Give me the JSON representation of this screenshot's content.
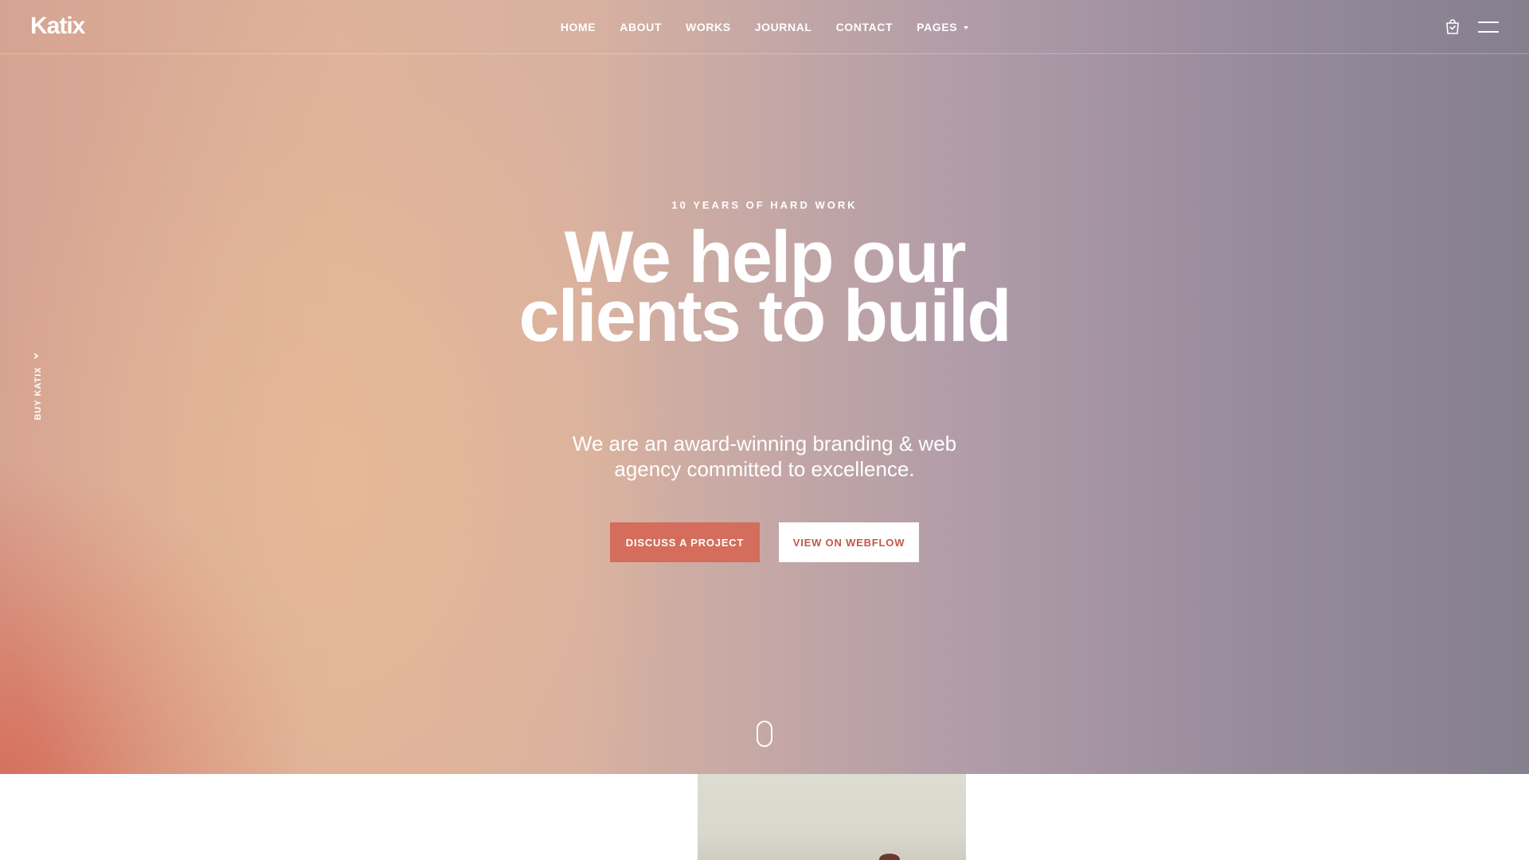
{
  "brand": {
    "logo": "Katix"
  },
  "nav": {
    "items": [
      {
        "label": "HOME"
      },
      {
        "label": "ABOUT"
      },
      {
        "label": "WORKS"
      },
      {
        "label": "JOURNAL"
      },
      {
        "label": "CONTACT"
      },
      {
        "label": "PAGES"
      }
    ]
  },
  "header_icons": {
    "cart": "cart-icon",
    "menu": "hamburger-icon"
  },
  "side": {
    "label": "BUY KATIX",
    "icon": "chevron-icon"
  },
  "hero": {
    "eyebrow": "10 YEARS OF HARD WORK",
    "headline_line1": "We help our",
    "headline_line2": "clients to build",
    "subtitle_line1": "We are an award-winning branding & web",
    "subtitle_line2": "agency committed to excellence.",
    "primary_button": "DISCUSS A PROJECT",
    "secondary_button": "VIEW ON WEBFLOW",
    "scroll_icon": "mouse-scroll-icon"
  },
  "colors": {
    "accent": "#d46d5b",
    "gradient_warm": "#e8b996",
    "gradient_cool": "#857f8e",
    "text": "#ffffff"
  }
}
